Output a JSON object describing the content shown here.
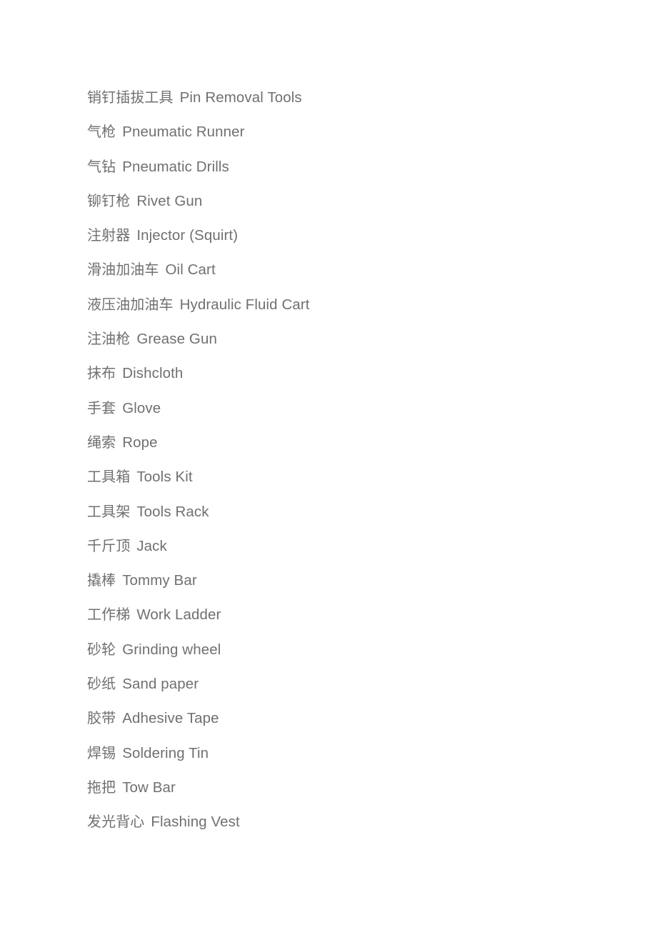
{
  "document": {
    "background_color": "#ffffff",
    "text_color": "#70706f",
    "entries": [
      {
        "zh": "销钉插拔工具",
        "en": "Pin Removal Tools"
      },
      {
        "zh": "气枪",
        "en": "Pneumatic Runner"
      },
      {
        "zh": "气钻",
        "en": "Pneumatic Drills"
      },
      {
        "zh": "铆钉枪",
        "en": "Rivet Gun"
      },
      {
        "zh": "注射器",
        "en": "Injector (Squirt)"
      },
      {
        "zh": "滑油加油车",
        "en": "Oil Cart"
      },
      {
        "zh": "液压油加油车",
        "en": "Hydraulic Fluid Cart"
      },
      {
        "zh": "注油枪",
        "en": "Grease Gun"
      },
      {
        "zh": "抹布",
        "en": "Dishcloth"
      },
      {
        "zh": "手套",
        "en": "Glove"
      },
      {
        "zh": "绳索",
        "en": "Rope"
      },
      {
        "zh": "工具箱",
        "en": "Tools Kit"
      },
      {
        "zh": "工具架",
        "en": "Tools Rack"
      },
      {
        "zh": "千斤顶",
        "en": "Jack"
      },
      {
        "zh": "撬棒",
        "en": "Tommy Bar"
      },
      {
        "zh": "工作梯",
        "en": "Work Ladder"
      },
      {
        "zh": "砂轮",
        "en": "Grinding wheel"
      },
      {
        "zh": "砂纸",
        "en": "Sand paper"
      },
      {
        "zh": "胶带",
        "en": "Adhesive Tape"
      },
      {
        "zh": "焊锡",
        "en": "Soldering Tin"
      },
      {
        "zh": "拖把",
        "en": "Tow Bar"
      },
      {
        "zh": "发光背心",
        "en": "Flashing Vest"
      }
    ]
  }
}
